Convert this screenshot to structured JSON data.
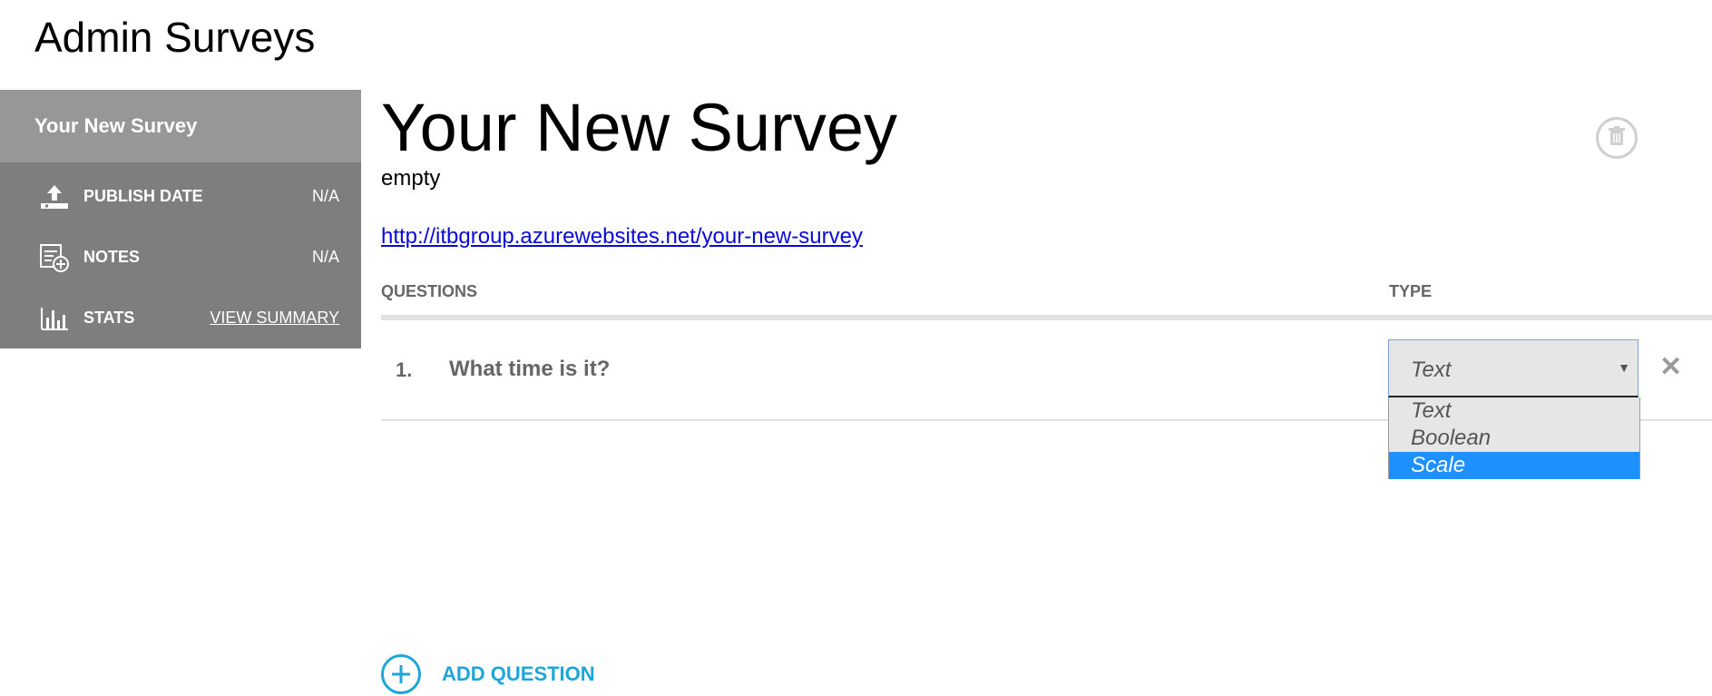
{
  "app": {
    "title": "Admin Surveys"
  },
  "sidebar": {
    "header": "Your New Survey",
    "rows": [
      {
        "icon": "upload-icon",
        "label": "PUBLISH DATE",
        "value": "N/A"
      },
      {
        "icon": "notes-add-icon",
        "label": "NOTES",
        "value": "N/A"
      },
      {
        "icon": "bar-chart-icon",
        "label": "STATS",
        "value": "VIEW SUMMARY"
      }
    ]
  },
  "survey": {
    "title": "Your New Survey",
    "description": "empty",
    "url": "http://itbgroup.azurewebsites.net/your-new-survey"
  },
  "questions_table": {
    "col_question": "QUESTIONS",
    "col_type": "TYPE",
    "rows": [
      {
        "number": "1.",
        "text": "What time is it?",
        "type": "Text"
      }
    ]
  },
  "type_dropdown": {
    "options": [
      "Text",
      "Boolean",
      "Scale"
    ],
    "highlighted": "Scale"
  },
  "actions": {
    "add_question": "ADD QUESTION"
  },
  "colors": {
    "sidebar_header": "#979797",
    "sidebar_body": "#7e7e7e",
    "accent": "#1fa6d8",
    "highlight": "#1e90ff"
  }
}
